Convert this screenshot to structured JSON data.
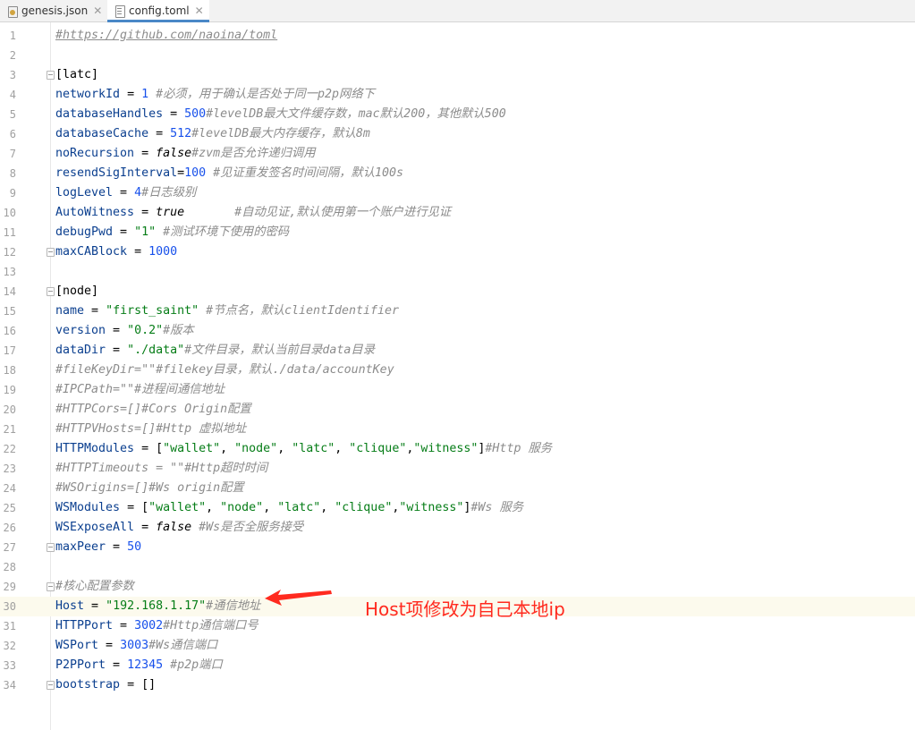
{
  "tabs": [
    {
      "label": "genesis.json",
      "icon": "json-file-icon",
      "active": false
    },
    {
      "label": "config.toml",
      "icon": "toml-file-icon",
      "active": true
    }
  ],
  "colors": {
    "key": "#0b3f8f",
    "number": "#1750eb",
    "string": "#067d17",
    "comment": "#8c8c8c",
    "annotation": "#ff2a1f",
    "highlight_line": "#fcfaed"
  },
  "highlighted_line": 30,
  "lines": [
    {
      "n": "1",
      "segs": [
        [
          "link",
          "#https://github.com/naoina/toml"
        ]
      ]
    },
    {
      "n": "2",
      "segs": []
    },
    {
      "n": "3",
      "fold": true,
      "segs": [
        [
          "p",
          "[latc]"
        ]
      ]
    },
    {
      "n": "4",
      "segs": [
        [
          "k",
          "networkId"
        ],
        [
          "p",
          " = "
        ],
        [
          "n",
          "1"
        ],
        [
          "p",
          " "
        ],
        [
          "c",
          "#必须，用于确认是否处于同一p2p网络下"
        ]
      ]
    },
    {
      "n": "5",
      "segs": [
        [
          "k",
          "databaseHandles"
        ],
        [
          "p",
          " = "
        ],
        [
          "n",
          "500"
        ],
        [
          "c",
          "#levelDB最大文件缓存数，mac默认200，其他默认500"
        ]
      ]
    },
    {
      "n": "6",
      "segs": [
        [
          "k",
          "databaseCache"
        ],
        [
          "p",
          " = "
        ],
        [
          "n",
          "512"
        ],
        [
          "c",
          "#levelDB最大内存缓存，默认8m"
        ]
      ]
    },
    {
      "n": "7",
      "segs": [
        [
          "k",
          "noRecursion"
        ],
        [
          "p",
          " = "
        ],
        [
          "b",
          "false"
        ],
        [
          "c",
          "#zvm是否允许递归调用"
        ]
      ]
    },
    {
      "n": "8",
      "segs": [
        [
          "k",
          "resendSigInterval"
        ],
        [
          "p",
          "="
        ],
        [
          "n",
          "100"
        ],
        [
          "p",
          " "
        ],
        [
          "c",
          "#见证重发签名时间间隔，默认100s"
        ]
      ]
    },
    {
      "n": "9",
      "segs": [
        [
          "k",
          "logLevel"
        ],
        [
          "p",
          " = "
        ],
        [
          "n",
          "4"
        ],
        [
          "c",
          "#日志级别"
        ]
      ]
    },
    {
      "n": "10",
      "segs": [
        [
          "k",
          "AutoWitness"
        ],
        [
          "p",
          " = "
        ],
        [
          "b",
          "true"
        ],
        [
          "p",
          "       "
        ],
        [
          "c",
          "#自动见证,默认使用第一个账户进行见证"
        ]
      ]
    },
    {
      "n": "11",
      "segs": [
        [
          "k",
          "debugPwd"
        ],
        [
          "p",
          " = "
        ],
        [
          "s",
          "\"1\""
        ],
        [
          "p",
          " "
        ],
        [
          "c",
          "#测试环境下使用的密码"
        ]
      ]
    },
    {
      "n": "12",
      "fold": true,
      "segs": [
        [
          "k",
          "maxCABlock"
        ],
        [
          "p",
          " = "
        ],
        [
          "n",
          "1000"
        ]
      ]
    },
    {
      "n": "13",
      "segs": []
    },
    {
      "n": "14",
      "fold": true,
      "segs": [
        [
          "p",
          "[node]"
        ]
      ]
    },
    {
      "n": "15",
      "segs": [
        [
          "k",
          "name"
        ],
        [
          "p",
          " = "
        ],
        [
          "s",
          "\"first_saint\""
        ],
        [
          "p",
          " "
        ],
        [
          "c",
          "#节点名，默认clientIdentifier"
        ]
      ]
    },
    {
      "n": "16",
      "segs": [
        [
          "k",
          "version"
        ],
        [
          "p",
          " = "
        ],
        [
          "s",
          "\"0.2\""
        ],
        [
          "c",
          "#版本"
        ]
      ]
    },
    {
      "n": "17",
      "segs": [
        [
          "k",
          "dataDir"
        ],
        [
          "p",
          " = "
        ],
        [
          "s",
          "\"./data\""
        ],
        [
          "c",
          "#文件目录，默认当前目录data目录"
        ]
      ]
    },
    {
      "n": "18",
      "segs": [
        [
          "c",
          "#fileKeyDir=\"\"#filekey目录，默认./data/accountKey"
        ]
      ]
    },
    {
      "n": "19",
      "segs": [
        [
          "c",
          "#IPCPath=\"\"#进程间通信地址"
        ]
      ]
    },
    {
      "n": "20",
      "segs": [
        [
          "c",
          "#HTTPCors=[]#Cors Origin配置"
        ]
      ]
    },
    {
      "n": "21",
      "segs": [
        [
          "c",
          "#HTTPVHosts=[]#Http 虚拟地址"
        ]
      ]
    },
    {
      "n": "22",
      "segs": [
        [
          "k",
          "HTTPModules"
        ],
        [
          "p",
          " = ["
        ],
        [
          "s",
          "\"wallet\""
        ],
        [
          "p",
          ", "
        ],
        [
          "s",
          "\"node\""
        ],
        [
          "p",
          ", "
        ],
        [
          "s",
          "\"latc\""
        ],
        [
          "p",
          ", "
        ],
        [
          "s",
          "\"clique\""
        ],
        [
          "p",
          ","
        ],
        [
          "s",
          "\"witness\""
        ],
        [
          "p",
          "]"
        ],
        [
          "c",
          "#Http 服务"
        ]
      ]
    },
    {
      "n": "23",
      "segs": [
        [
          "c",
          "#HTTPTimeouts = \"\"#Http超时时间"
        ]
      ]
    },
    {
      "n": "24",
      "segs": [
        [
          "c",
          "#WSOrigins=[]#Ws origin配置"
        ]
      ]
    },
    {
      "n": "25",
      "segs": [
        [
          "k",
          "WSModules"
        ],
        [
          "p",
          " = ["
        ],
        [
          "s",
          "\"wallet\""
        ],
        [
          "p",
          ", "
        ],
        [
          "s",
          "\"node\""
        ],
        [
          "p",
          ", "
        ],
        [
          "s",
          "\"latc\""
        ],
        [
          "p",
          ", "
        ],
        [
          "s",
          "\"clique\""
        ],
        [
          "p",
          ","
        ],
        [
          "s",
          "\"witness\""
        ],
        [
          "p",
          "]"
        ],
        [
          "c",
          "#Ws 服务"
        ]
      ]
    },
    {
      "n": "26",
      "segs": [
        [
          "k",
          "WSExposeAll"
        ],
        [
          "p",
          " = "
        ],
        [
          "b",
          "false"
        ],
        [
          "p",
          " "
        ],
        [
          "c",
          "#Ws是否全服务接受"
        ]
      ]
    },
    {
      "n": "27",
      "fold": true,
      "segs": [
        [
          "k",
          "maxPeer"
        ],
        [
          "p",
          " = "
        ],
        [
          "n",
          "50"
        ]
      ]
    },
    {
      "n": "28",
      "segs": []
    },
    {
      "n": "29",
      "fold": true,
      "segs": [
        [
          "c",
          "#核心配置参数"
        ]
      ]
    },
    {
      "n": "30",
      "segs": [
        [
          "k",
          "Host"
        ],
        [
          "p",
          " = "
        ],
        [
          "s",
          "\"192.168.1.17\""
        ],
        [
          "c",
          "#通信地址"
        ]
      ]
    },
    {
      "n": "31",
      "segs": [
        [
          "k",
          "HTTPPort"
        ],
        [
          "p",
          " = "
        ],
        [
          "n",
          "3002"
        ],
        [
          "c",
          "#Http通信端口号"
        ]
      ]
    },
    {
      "n": "32",
      "segs": [
        [
          "k",
          "WSPort"
        ],
        [
          "p",
          " = "
        ],
        [
          "n",
          "3003"
        ],
        [
          "c",
          "#Ws通信端口"
        ]
      ]
    },
    {
      "n": "33",
      "segs": [
        [
          "k",
          "P2PPort"
        ],
        [
          "p",
          " = "
        ],
        [
          "n",
          "12345"
        ],
        [
          "p",
          " "
        ],
        [
          "c",
          "#p2p端口"
        ]
      ]
    },
    {
      "n": "34",
      "fold": true,
      "segs": [
        [
          "k",
          "bootstrap"
        ],
        [
          "p",
          " = []"
        ]
      ]
    }
  ],
  "annotation": {
    "text": "Host项修改为自己本地ip",
    "arrow": "red-arrow-pointing-left"
  }
}
